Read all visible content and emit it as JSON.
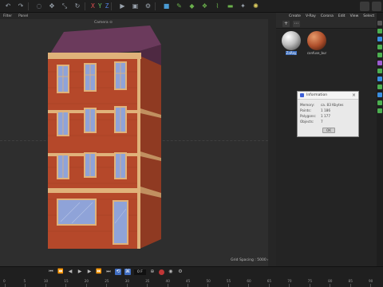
{
  "viewport": {
    "menu": [
      "Filter",
      "Panel"
    ],
    "camera_label": "Camera",
    "camera_icon": "camera-icon",
    "grid_spacing": "Grid Spacing : 5000 cm"
  },
  "right_panel": {
    "menu": [
      "Create",
      "V-Ray",
      "Corona",
      "Edit",
      "View",
      "Select"
    ],
    "materials": [
      {
        "name": "ZaRay",
        "selected": true,
        "color": "#e5e5e5"
      },
      {
        "name": "confuse_bur",
        "selected": false,
        "color": "#c46a3c"
      }
    ]
  },
  "dialog": {
    "title": "Information",
    "rows": [
      {
        "key": "Memory:",
        "value": "ca. 83 Kbytes"
      },
      {
        "key": "Points:",
        "value": "1 186"
      },
      {
        "key": "Polygons:",
        "value": "1 177"
      },
      {
        "key": "Objects:",
        "value": "7"
      }
    ],
    "ok_label": "OK"
  },
  "timeline": {
    "current_frame": "0 F",
    "ticks": [
      "0",
      "5",
      "10",
      "15",
      "20",
      "25",
      "30",
      "35",
      "40",
      "45",
      "50",
      "55",
      "60",
      "65",
      "70",
      "75",
      "80",
      "85",
      "90"
    ]
  },
  "toolbar": {
    "axes": [
      "X",
      "Y",
      "Z"
    ]
  },
  "colors": {
    "brick": "#b5482a",
    "trim": "#e0b27a",
    "roof": "#6b3a5c",
    "window_glass": "#8fa3d8",
    "accent_blue": "#3e6cc0"
  }
}
